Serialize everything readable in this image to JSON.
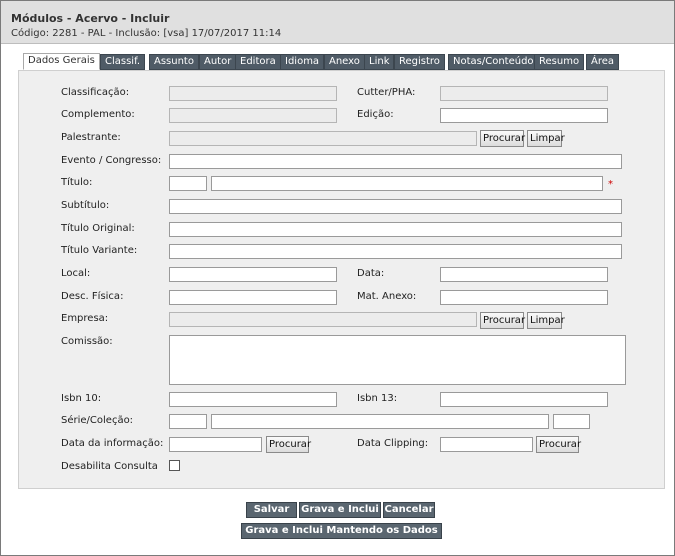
{
  "header": {
    "title": "Módulos - Acervo - Incluir",
    "subtitle": "Código: 2281 - PAL - Inclusão: [vsa] 17/07/2017 11:14"
  },
  "tabs": [
    {
      "label": "Dados Gerais"
    },
    {
      "label": "Classif."
    },
    {
      "label": "Assunto"
    },
    {
      "label": "Autor"
    },
    {
      "label": "Editora"
    },
    {
      "label": "Idioma"
    },
    {
      "label": "Anexo"
    },
    {
      "label": "Link"
    },
    {
      "label": "Registro"
    },
    {
      "label": "Notas/Conteúdo"
    },
    {
      "label": "Resumo"
    },
    {
      "label": "Área"
    }
  ],
  "form": {
    "classificacao": "Classificação:",
    "cutter": "Cutter/PHA:",
    "complemento": "Complemento:",
    "edicao": "Edição:",
    "palestrante": "Palestrante:",
    "evento": "Evento / Congresso:",
    "titulo": "Título:",
    "subtitulo": "Subtítulo:",
    "titulo_original": "Título Original:",
    "titulo_variante": "Título Variante:",
    "local": "Local:",
    "data": "Data:",
    "desc_fisica": "Desc. Física:",
    "mat_anexo": "Mat. Anexo:",
    "empresa": "Empresa:",
    "comissao": "Comissão:",
    "isbn10": "Isbn 10:",
    "isbn13": "Isbn 13:",
    "serie": "Série/Coleção:",
    "data_informacao": "Data da informação:",
    "data_clipping": "Data Clipping:",
    "desabilita": "Desabilita Consulta",
    "required_mark": "*"
  },
  "buttons": {
    "procurar": "Procurar",
    "limpar": "Limpar",
    "salvar": "Salvar",
    "grava_inclui": "Grava e Inclui",
    "cancelar": "Cancelar",
    "grava_mantendo": "Grava e Inclui Mantendo os Dados"
  }
}
